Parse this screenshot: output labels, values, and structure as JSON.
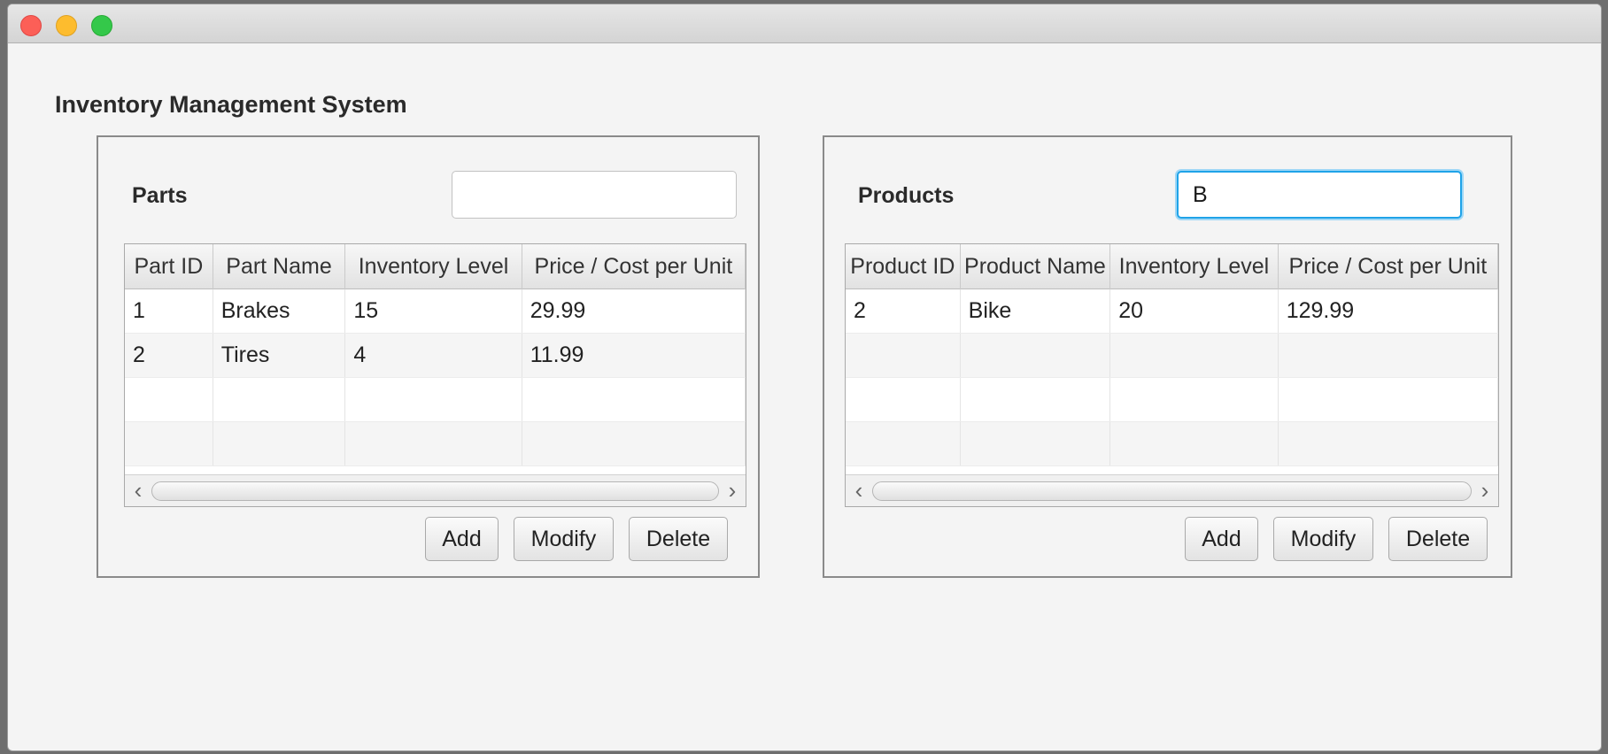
{
  "app": {
    "title": "Inventory Management System"
  },
  "parts": {
    "title": "Parts",
    "search": {
      "value": "",
      "placeholder": ""
    },
    "columns": [
      "Part ID",
      "Part Name",
      "Inventory Level",
      "Price / Cost per Unit"
    ],
    "rows": [
      [
        "1",
        "Brakes",
        "15",
        "29.99"
      ],
      [
        "2",
        "Tires",
        "4",
        "11.99"
      ]
    ],
    "buttons": {
      "add": "Add",
      "modify": "Modify",
      "delete": "Delete"
    }
  },
  "products": {
    "title": "Products",
    "search": {
      "value": "B",
      "placeholder": ""
    },
    "columns": [
      "Product ID",
      "Product Name",
      "Inventory Level",
      "Price / Cost per Unit"
    ],
    "rows": [
      [
        "2",
        "Bike",
        "20",
        "129.99"
      ]
    ],
    "buttons": {
      "add": "Add",
      "modify": "Modify",
      "delete": "Delete"
    }
  },
  "icons": {
    "scroll_left": "‹",
    "scroll_right": "›"
  },
  "colors": {
    "focus_ring": "#1fa3e8",
    "traffic_close": "#fc5f57",
    "traffic_minimize": "#fdbc2e",
    "traffic_maximize": "#34c84a"
  }
}
